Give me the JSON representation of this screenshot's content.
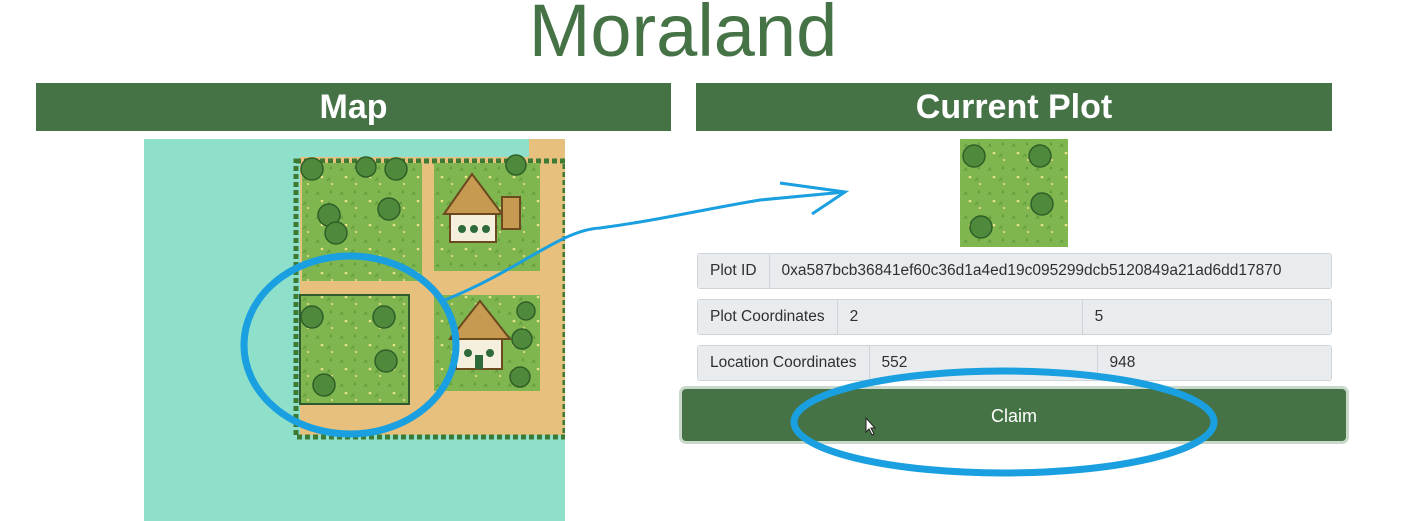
{
  "app": {
    "title": "Moraland"
  },
  "map_panel": {
    "header": "Map"
  },
  "plot_panel": {
    "header": "Current Plot",
    "plot_id": {
      "label": "Plot ID",
      "value": "0xa587bcb36841ef60c36d1a4ed19c095299dcb5120849a21ad6dd17870"
    },
    "plot_coordinates": {
      "label": "Plot Coordinates",
      "x": "2",
      "y": "5"
    },
    "location_coordinates": {
      "label": "Location Coordinates",
      "x": "552",
      "y": "948"
    },
    "claim_label": "Claim"
  },
  "colors": {
    "brand_green": "#457346",
    "water": "#8ee0cb",
    "grass": "#7fb650",
    "sand": "#e6c07c",
    "annotation_blue": "#1aa0e0"
  },
  "icons": [
    "tree-icon",
    "house-icon",
    "pointer-cursor-icon",
    "annotation-arrow-icon"
  ]
}
